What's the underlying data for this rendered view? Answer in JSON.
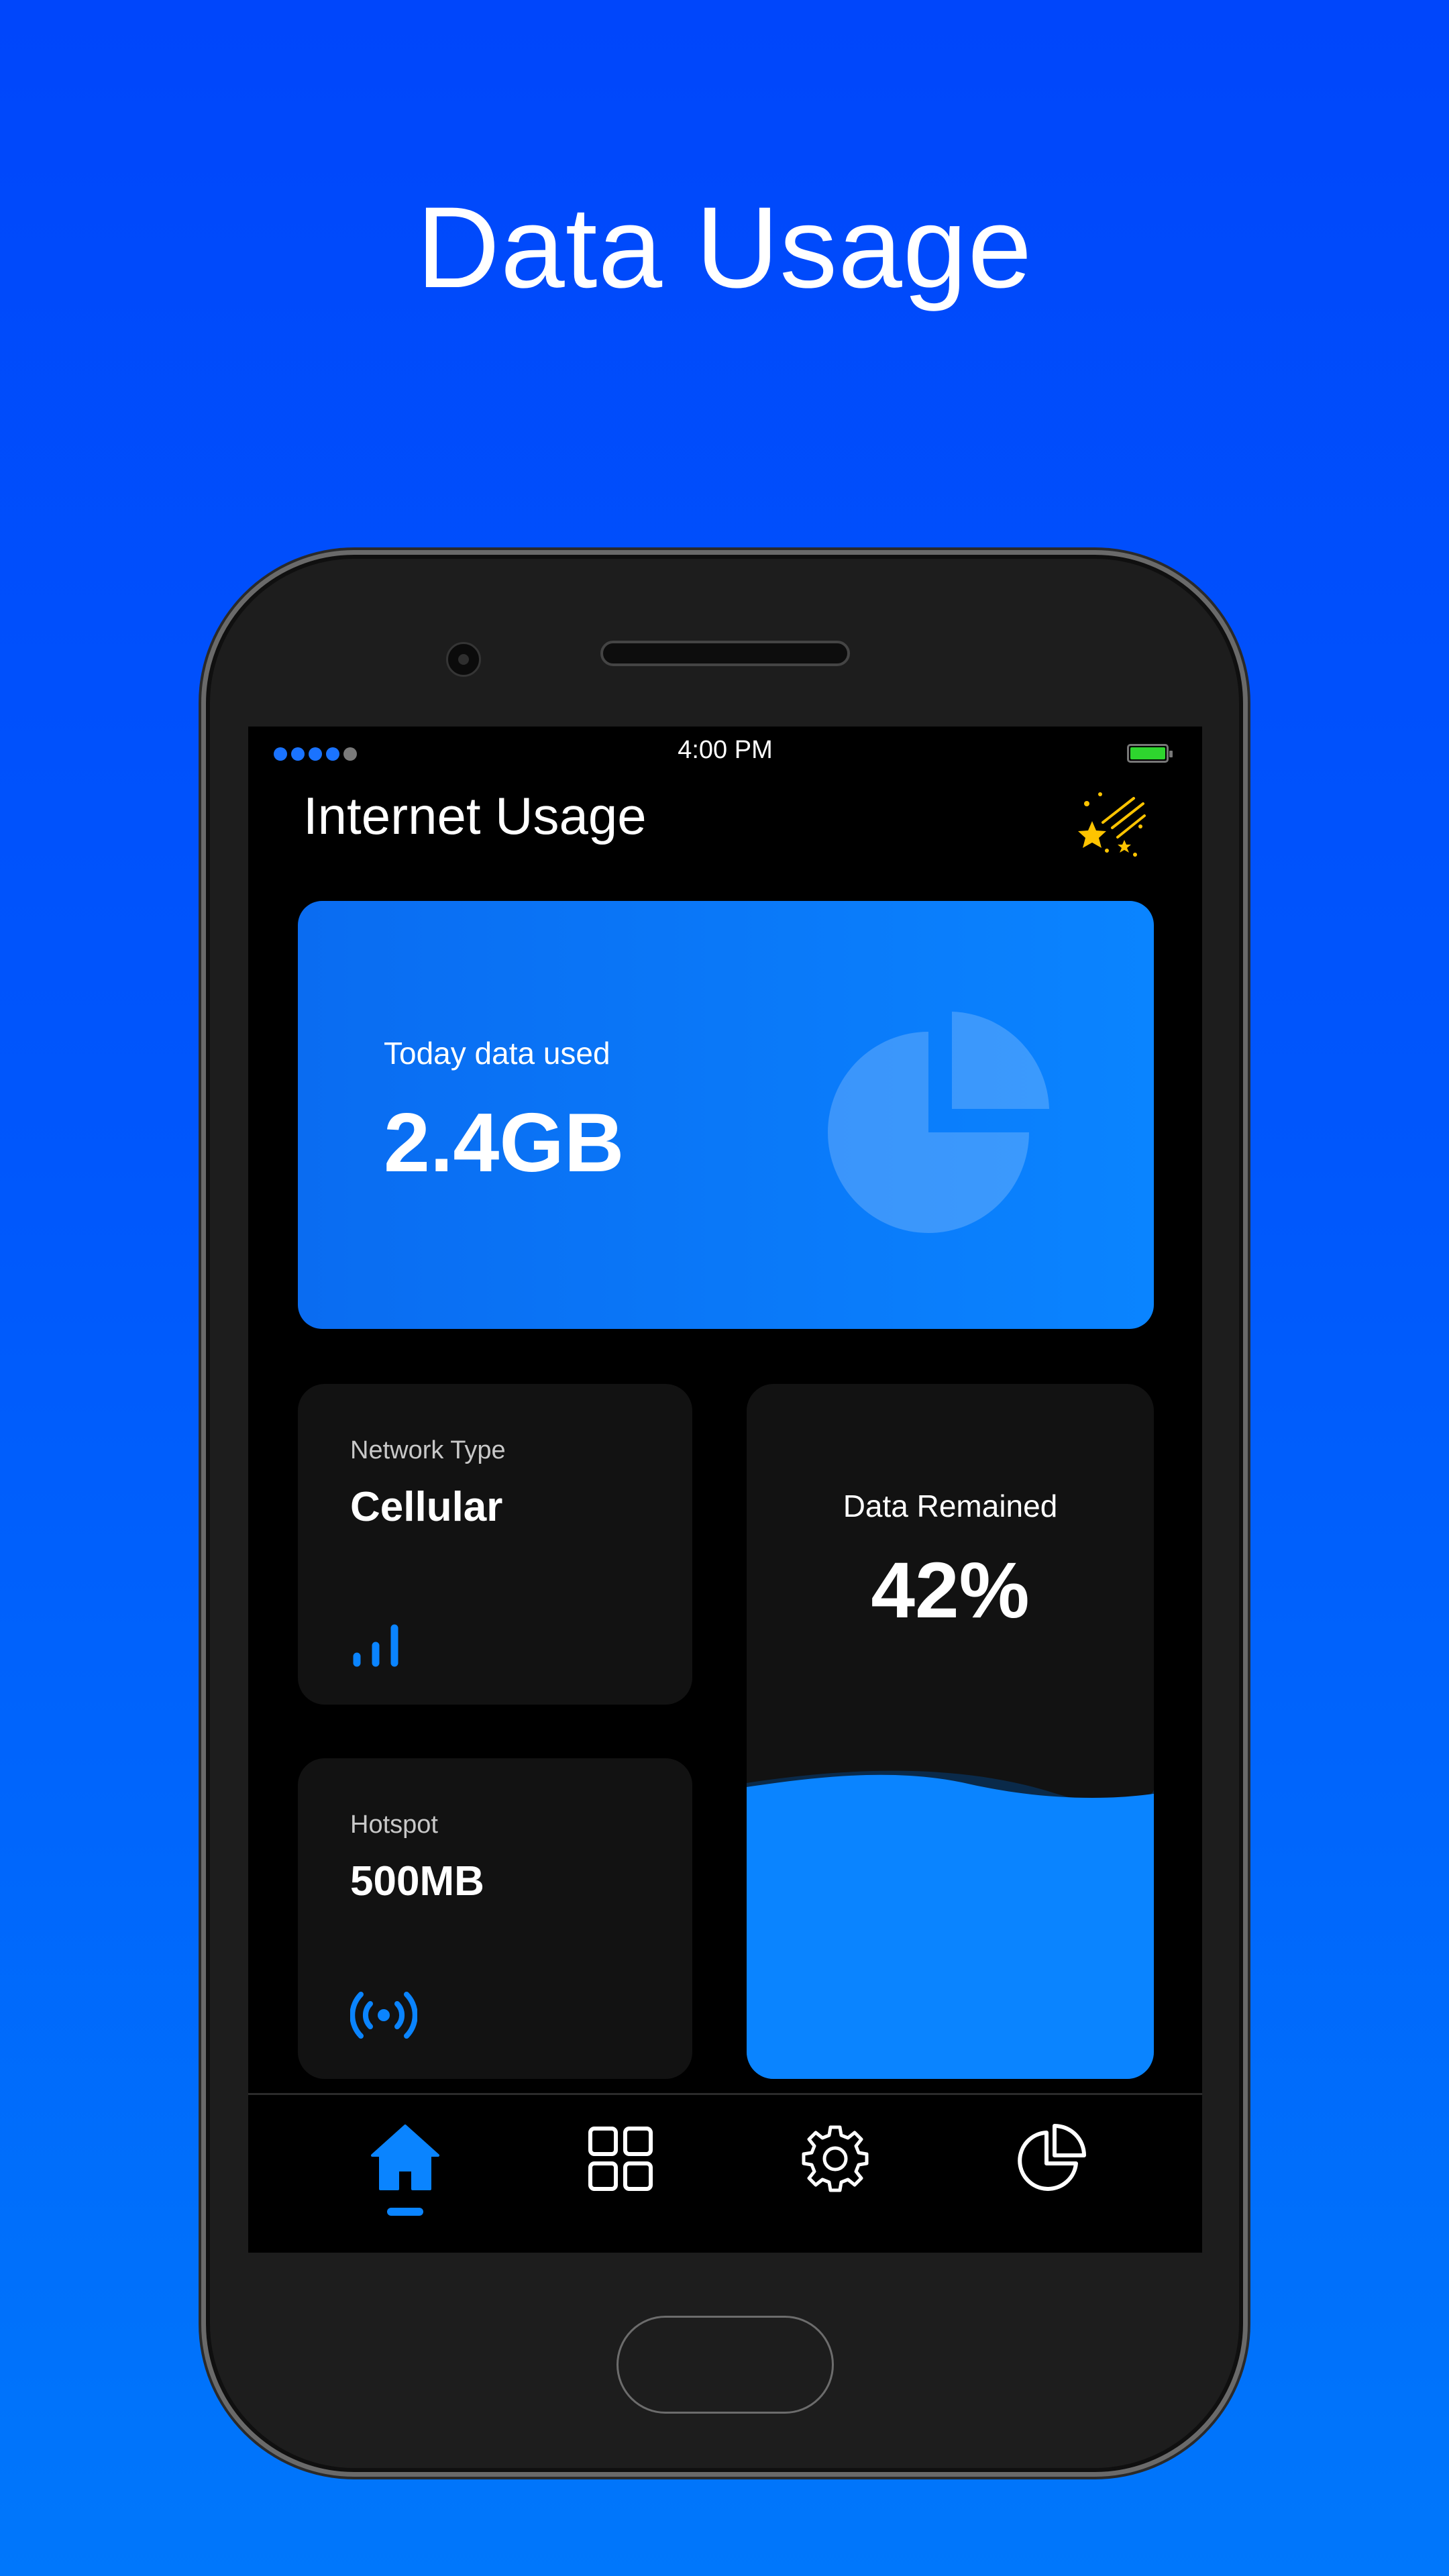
{
  "headline": "Data Usage",
  "status_bar": {
    "time": "4:00 PM",
    "signal_dots": 5,
    "signal_active": 4,
    "battery_color": "#2ed52e"
  },
  "app": {
    "title": "Internet Usage",
    "action_icon": "stars-icon"
  },
  "today_card": {
    "label": "Today data used",
    "value": "2.4GB",
    "icon": "pie-chart-icon"
  },
  "network_card": {
    "label": "Network Type",
    "value": "Cellular",
    "icon": "signal-bars-icon"
  },
  "hotspot_card": {
    "label": "Hotspot",
    "value": "500MB",
    "icon": "hotspot-icon"
  },
  "remained_card": {
    "label": "Data Remained",
    "value": "42%",
    "fill_fraction": 0.42
  },
  "bottom_nav": {
    "items": [
      {
        "name": "home",
        "icon": "home-icon",
        "active": true
      },
      {
        "name": "grid",
        "icon": "grid-icon",
        "active": false
      },
      {
        "name": "settings",
        "icon": "gear-icon",
        "active": false
      },
      {
        "name": "stats",
        "icon": "pie-chart-icon",
        "active": false
      }
    ]
  },
  "colors": {
    "accent": "#0a84ff",
    "background_top": "#0046fb",
    "background_bottom": "#0077fb",
    "card_dark": "#121212",
    "screen": "#000000",
    "star": "#ffc400"
  }
}
